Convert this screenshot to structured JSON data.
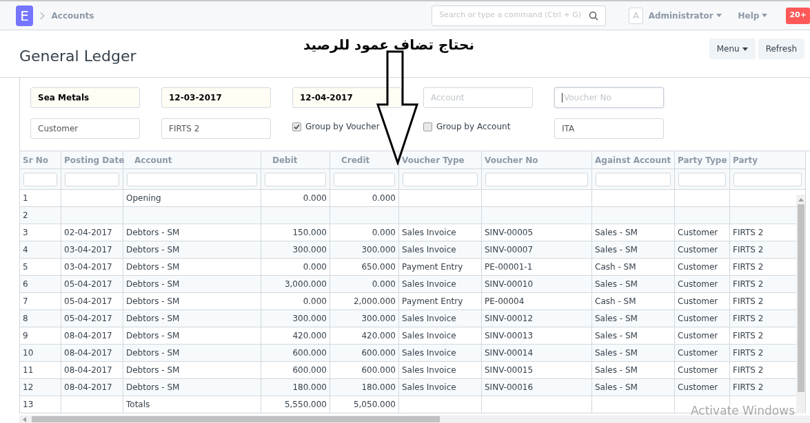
{
  "navbar": {
    "logo": "E",
    "breadcrumb": "Accounts",
    "search": {
      "placeholder": "Search or type a command (Ctrl + G)"
    },
    "avatar": "A",
    "user": "Administrator",
    "help": "Help",
    "notifications": "20+"
  },
  "page": {
    "title": "General Ledger",
    "buttons": [
      {
        "label": "Menu",
        "dropdown": true
      },
      {
        "label": "Refresh",
        "dropdown": false
      }
    ]
  },
  "filters": [
    {
      "kind": "field",
      "value": "Sea Metals",
      "required": true
    },
    {
      "kind": "field",
      "value": "12-03-2017",
      "required": true
    },
    {
      "kind": "field",
      "value": "12-04-2017",
      "required": true
    },
    {
      "kind": "field",
      "placeholder": "Account",
      "required": false
    },
    {
      "kind": "field",
      "placeholder": "Voucher No",
      "required": false,
      "focused": true
    },
    {
      "kind": "field",
      "value": "Customer",
      "required": false
    },
    {
      "kind": "field",
      "value": "FIRTS 2",
      "required": false
    },
    {
      "kind": "checkbox",
      "label": "Group by Voucher",
      "checked": true
    },
    {
      "kind": "checkbox",
      "label": "Group by Account",
      "checked": false
    },
    {
      "kind": "field",
      "value": "ITA",
      "required": false
    }
  ],
  "table": {
    "columns": [
      "Sr No",
      "Posting Date",
      "Account",
      "Debit",
      "Credit",
      "Voucher Type",
      "Voucher No",
      "Against Account",
      "Party Type",
      "Party"
    ],
    "rows": [
      {
        "sr_no": "1",
        "account": "Opening",
        "debit": "0.000",
        "credit": "0.000"
      },
      {
        "sr_no": "2"
      },
      {
        "sr_no": "3",
        "posting_date": "02-04-2017",
        "account": "Debtors - SM",
        "debit": "150.000",
        "credit": "0.000",
        "voucher_type": "Sales Invoice",
        "voucher_no": "SINV-00005",
        "against_account": "Sales - SM",
        "party_type": "Customer",
        "party": "FIRTS 2"
      },
      {
        "sr_no": "4",
        "posting_date": "03-04-2017",
        "account": "Debtors - SM",
        "debit": "300.000",
        "credit": "300.000",
        "voucher_type": "Sales Invoice",
        "voucher_no": "SINV-00007",
        "against_account": "Sales - SM",
        "party_type": "Customer",
        "party": "FIRTS 2"
      },
      {
        "sr_no": "5",
        "posting_date": "03-04-2017",
        "account": "Debtors - SM",
        "debit": "0.000",
        "credit": "650.000",
        "voucher_type": "Payment Entry",
        "voucher_no": "PE-00001-1",
        "against_account": "Cash - SM",
        "party_type": "Customer",
        "party": "FIRTS 2"
      },
      {
        "sr_no": "6",
        "posting_date": "05-04-2017",
        "account": "Debtors - SM",
        "debit": "3,000.000",
        "credit": "0.000",
        "voucher_type": "Sales Invoice",
        "voucher_no": "SINV-00010",
        "against_account": "Sales - SM",
        "party_type": "Customer",
        "party": "FIRTS 2"
      },
      {
        "sr_no": "7",
        "posting_date": "05-04-2017",
        "account": "Debtors - SM",
        "debit": "0.000",
        "credit": "2,000.000",
        "voucher_type": "Payment Entry",
        "voucher_no": "PE-00004",
        "against_account": "Cash - SM",
        "party_type": "Customer",
        "party": "FIRTS 2"
      },
      {
        "sr_no": "8",
        "posting_date": "05-04-2017",
        "account": "Debtors - SM",
        "debit": "300.000",
        "credit": "300.000",
        "voucher_type": "Sales Invoice",
        "voucher_no": "SINV-00012",
        "against_account": "Sales - SM",
        "party_type": "Customer",
        "party": "FIRTS 2"
      },
      {
        "sr_no": "9",
        "posting_date": "08-04-2017",
        "account": "Debtors - SM",
        "debit": "420.000",
        "credit": "420.000",
        "voucher_type": "Sales Invoice",
        "voucher_no": "SINV-00013",
        "against_account": "Sales - SM",
        "party_type": "Customer",
        "party": "FIRTS 2"
      },
      {
        "sr_no": "10",
        "posting_date": "08-04-2017",
        "account": "Debtors - SM",
        "debit": "600.000",
        "credit": "600.000",
        "voucher_type": "Sales Invoice",
        "voucher_no": "SINV-00014",
        "against_account": "Sales - SM",
        "party_type": "Customer",
        "party": "FIRTS 2"
      },
      {
        "sr_no": "11",
        "posting_date": "08-04-2017",
        "account": "Debtors - SM",
        "debit": "600.000",
        "credit": "600.000",
        "voucher_type": "Sales Invoice",
        "voucher_no": "SINV-00015",
        "against_account": "Sales - SM",
        "party_type": "Customer",
        "party": "FIRTS 2"
      },
      {
        "sr_no": "12",
        "posting_date": "08-04-2017",
        "account": "Debtors - SM",
        "debit": "180.000",
        "credit": "180.000",
        "voucher_type": "Sales Invoice",
        "voucher_no": "SINV-00016",
        "against_account": "Sales - SM",
        "party_type": "Customer",
        "party": "FIRTS 2"
      },
      {
        "sr_no": "13",
        "account": "Totals",
        "debit": "5,550.000",
        "credit": "5,050.000"
      }
    ]
  },
  "annotation": {
    "text": "نحتاج تضاف عمود للرصيد"
  },
  "os_notice": "Activate Windows"
}
